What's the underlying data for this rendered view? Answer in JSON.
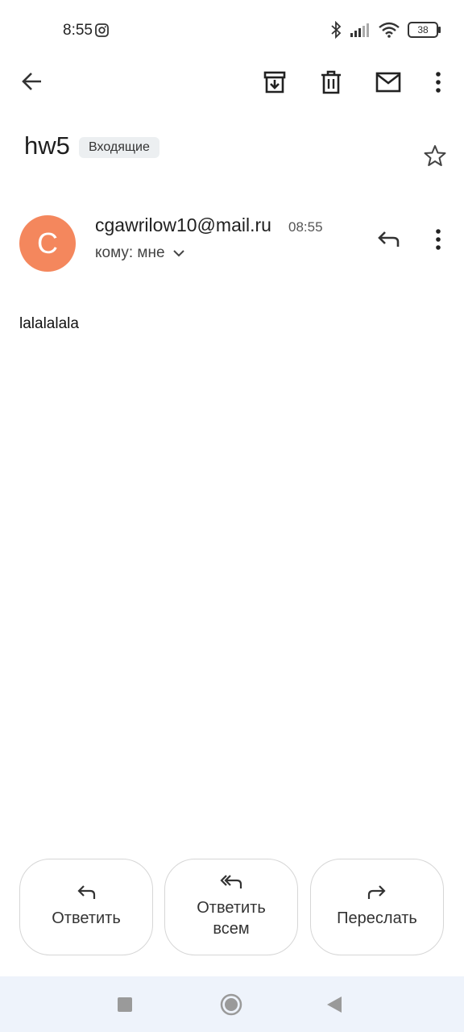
{
  "status_bar": {
    "time": "8:55",
    "battery": "38",
    "icons": [
      "instagram-icon",
      "bluetooth-icon",
      "signal-icon",
      "wifi-icon",
      "battery-icon"
    ]
  },
  "toolbar": {
    "icons": [
      "back-arrow-icon",
      "archive-icon",
      "delete-icon",
      "mark-unread-icon",
      "more-vert-icon"
    ]
  },
  "email": {
    "subject": "hw5",
    "label": "Входящие",
    "sender_initial": "C",
    "sender": "cgawrilow10@mail.ru",
    "time": "08:55",
    "to": "кому: мне",
    "body": "lalalalala"
  },
  "actions": {
    "reply": "Ответить",
    "reply_all": "Ответить всем",
    "forward": "Переслать"
  },
  "colors": {
    "avatar": "#f4875d",
    "navbar": "#eef3fb"
  }
}
